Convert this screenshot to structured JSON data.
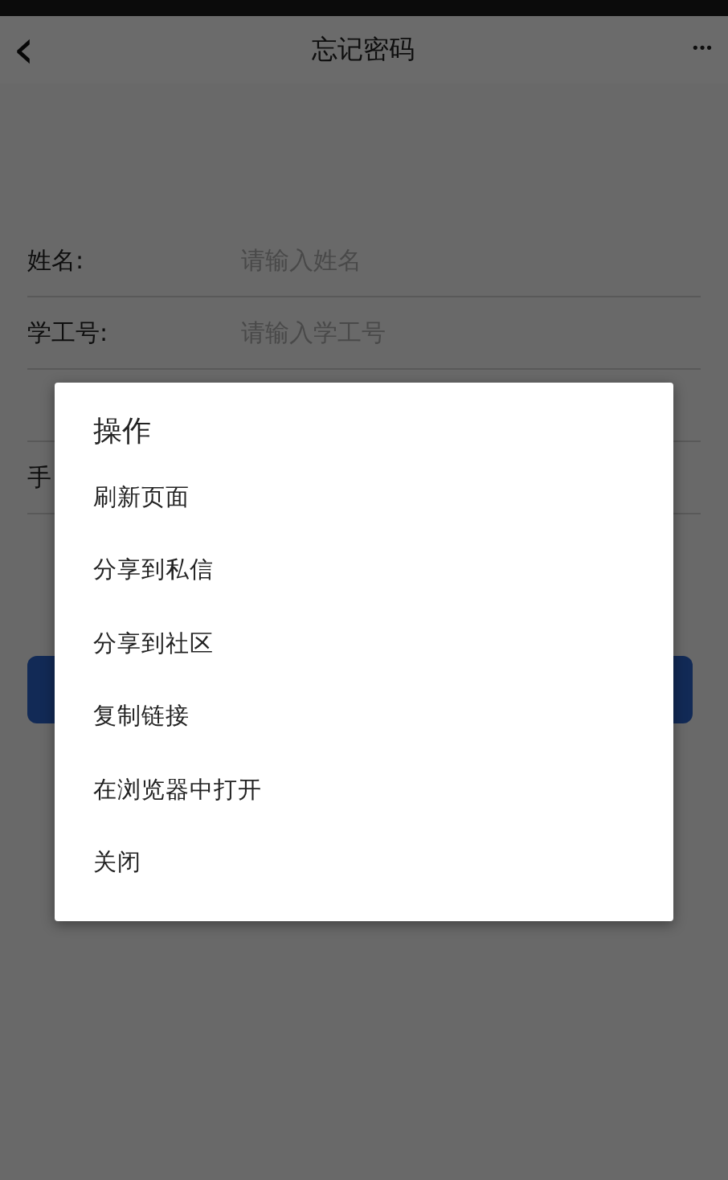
{
  "nav_bar": {
    "back_icon": "‹",
    "title": "忘记密码",
    "more": "•••"
  },
  "form": {
    "rows": [
      {
        "label": "姓名:",
        "placeholder": "请输入姓名"
      },
      {
        "label": "学工号:",
        "placeholder": "请输入学工号"
      },
      {},
      {
        "label": "手"
      }
    ]
  },
  "dialog": {
    "title": "操作",
    "items": [
      "刷新页面",
      "分享到私信",
      "分享到社区",
      "复制链接",
      "在浏览器中打开",
      "关闭"
    ]
  }
}
